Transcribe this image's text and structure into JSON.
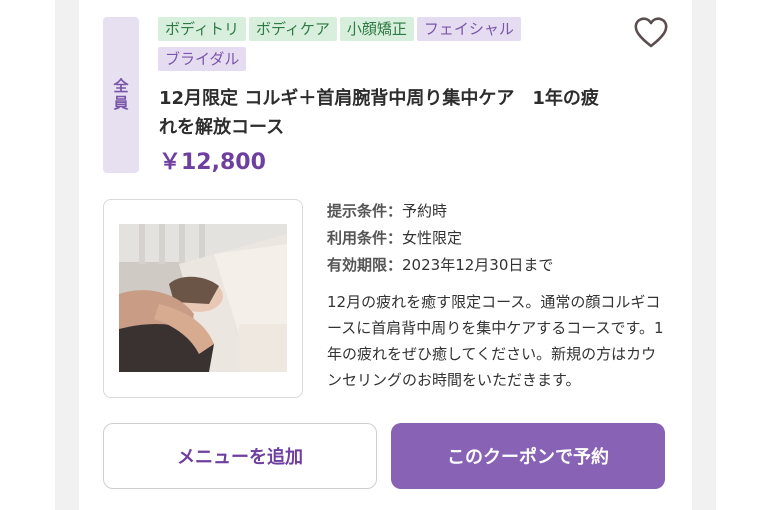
{
  "coupon": {
    "target_badge": "全員",
    "tags": [
      {
        "label": "ボディトリ",
        "color": "green"
      },
      {
        "label": "ボディケア",
        "color": "green"
      },
      {
        "label": "小顔矯正",
        "color": "green"
      },
      {
        "label": "フェイシャル",
        "color": "purple"
      },
      {
        "label": "ブライダル",
        "color": "purple"
      }
    ],
    "title_line1": "12月限定 コルギ＋首肩腕背中周り集中ケア　1年の疲",
    "title_line2": "れを解放コース",
    "price": "￥12,800",
    "conditions": {
      "present_label": "提示条件：",
      "present_value": "予約時",
      "use_label": "利用条件：",
      "use_value": "女性限定",
      "valid_label": "有効期限：",
      "valid_value": "2023年12月30日まで"
    },
    "description": "12月の疲れを癒す限定コース。通常の顔コルギコースに首肩背中周りを集中ケアするコースです。1年の疲れをぜひ癒してください。新規の方はカウンセリングのお時間をいただきます。",
    "add_menu_label": "メニューを追加",
    "reserve_label": "このクーポンで予約"
  },
  "icons": {
    "favorite": "heart-outline-icon"
  },
  "colors": {
    "accent": "#8862b5",
    "price": "#6f3fa0",
    "tag_green_bg": "#d7efdc",
    "tag_purple_bg": "#e6dcf2"
  }
}
